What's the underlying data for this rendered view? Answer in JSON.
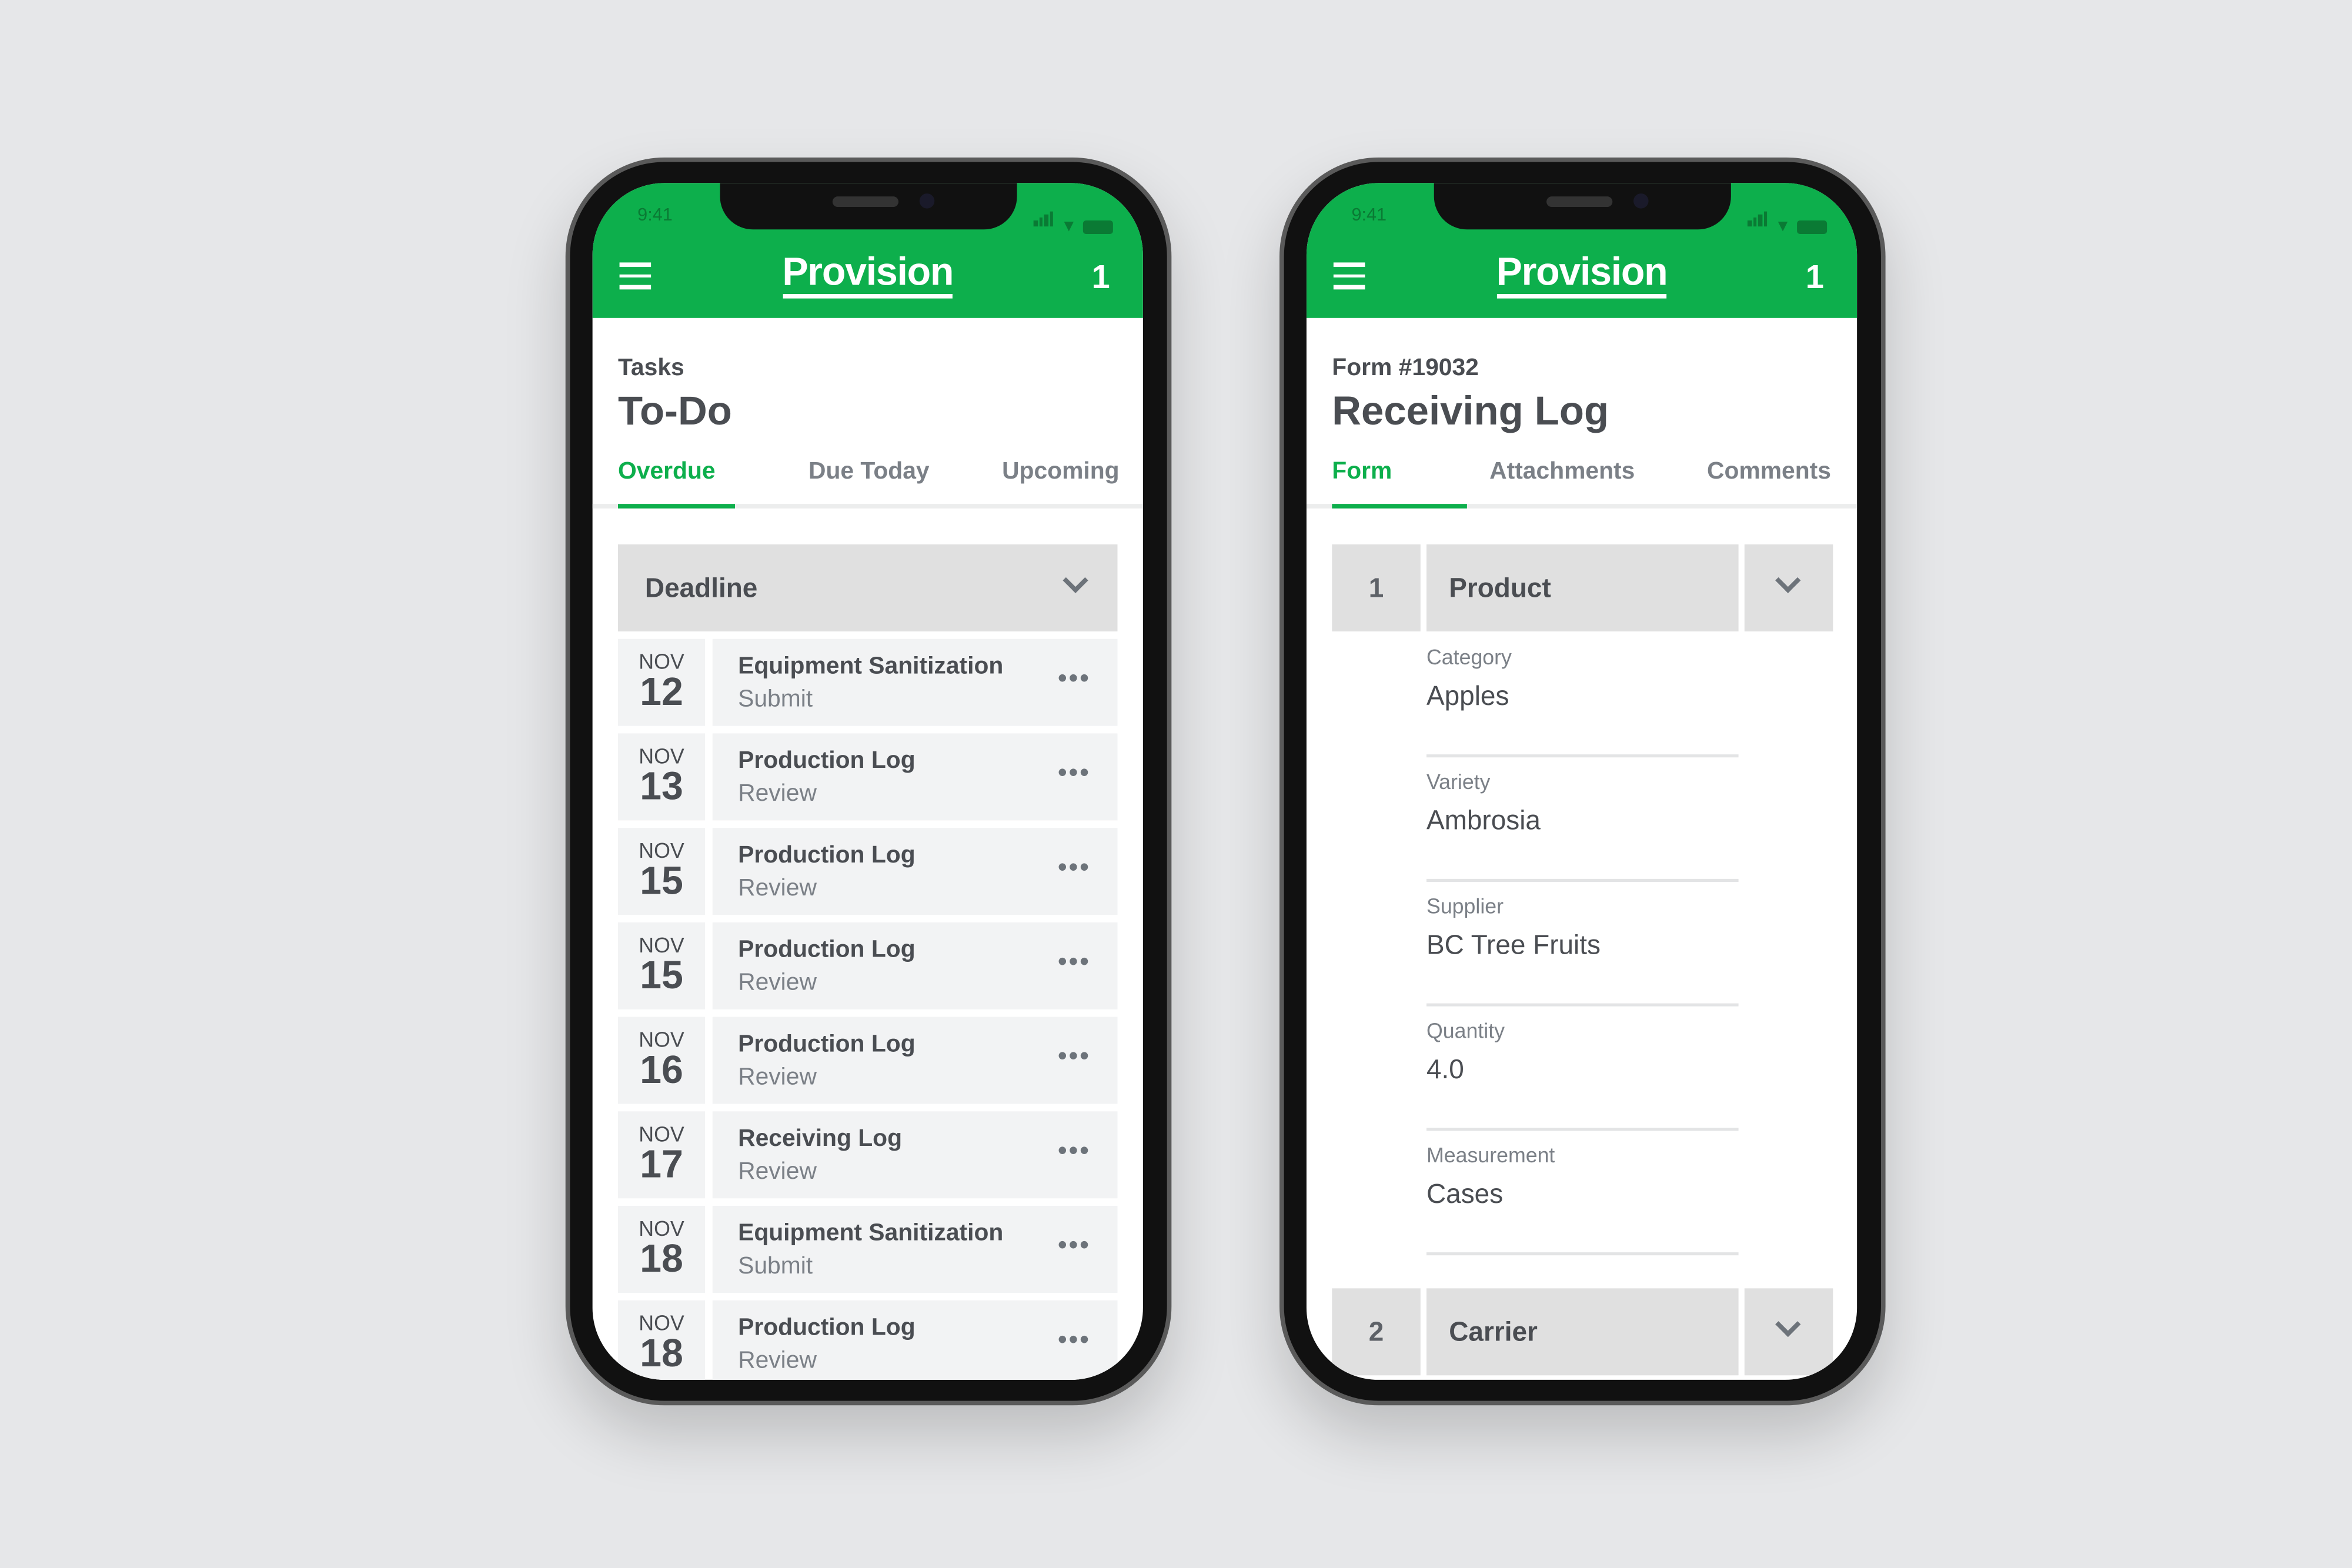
{
  "colors": {
    "brand": "#0daf4c",
    "background": "#e6e7e9",
    "header_gray": "#e0e0e0",
    "row_gray": "#f2f3f4"
  },
  "status_bar": {
    "time": "9:41"
  },
  "app": {
    "logo": "Provision",
    "badge": "1",
    "menu_icon": "hamburger-icon"
  },
  "tasks_screen": {
    "subtitle": "Tasks",
    "title": "To-Do",
    "tabs": [
      {
        "label": "Overdue",
        "active": true
      },
      {
        "label": "Due Today"
      },
      {
        "label": "Upcoming"
      }
    ],
    "sort_label": "Deadline",
    "items": [
      {
        "month": "NOV",
        "day": "12",
        "name": "Equipment Sanitization",
        "action": "Submit"
      },
      {
        "month": "NOV",
        "day": "13",
        "name": "Production Log",
        "action": "Review"
      },
      {
        "month": "NOV",
        "day": "15",
        "name": "Production Log",
        "action": "Review"
      },
      {
        "month": "NOV",
        "day": "15",
        "name": "Production Log",
        "action": "Review"
      },
      {
        "month": "NOV",
        "day": "16",
        "name": "Production Log",
        "action": "Review"
      },
      {
        "month": "NOV",
        "day": "17",
        "name": "Receiving Log",
        "action": "Review"
      },
      {
        "month": "NOV",
        "day": "18",
        "name": "Equipment Sanitization",
        "action": "Submit"
      },
      {
        "month": "NOV",
        "day": "18",
        "name": "Production Log",
        "action": "Review"
      }
    ],
    "more": "•••"
  },
  "form_screen": {
    "subtitle": "Form #19032",
    "title": "Receiving Log",
    "tabs": [
      {
        "label": "Form",
        "active": true
      },
      {
        "label": "Attachments"
      },
      {
        "label": "Comments"
      }
    ],
    "sections": [
      {
        "number": "1",
        "title": "Product"
      },
      {
        "number": "2",
        "title": "Carrier"
      }
    ],
    "fields": [
      {
        "label": "Category",
        "value": "Apples"
      },
      {
        "label": "Variety",
        "value": "Ambrosia"
      },
      {
        "label": "Supplier",
        "value": "BC Tree Fruits"
      },
      {
        "label": "Quantity",
        "value": "4.0"
      },
      {
        "label": "Measurement",
        "value": "Cases"
      }
    ]
  }
}
